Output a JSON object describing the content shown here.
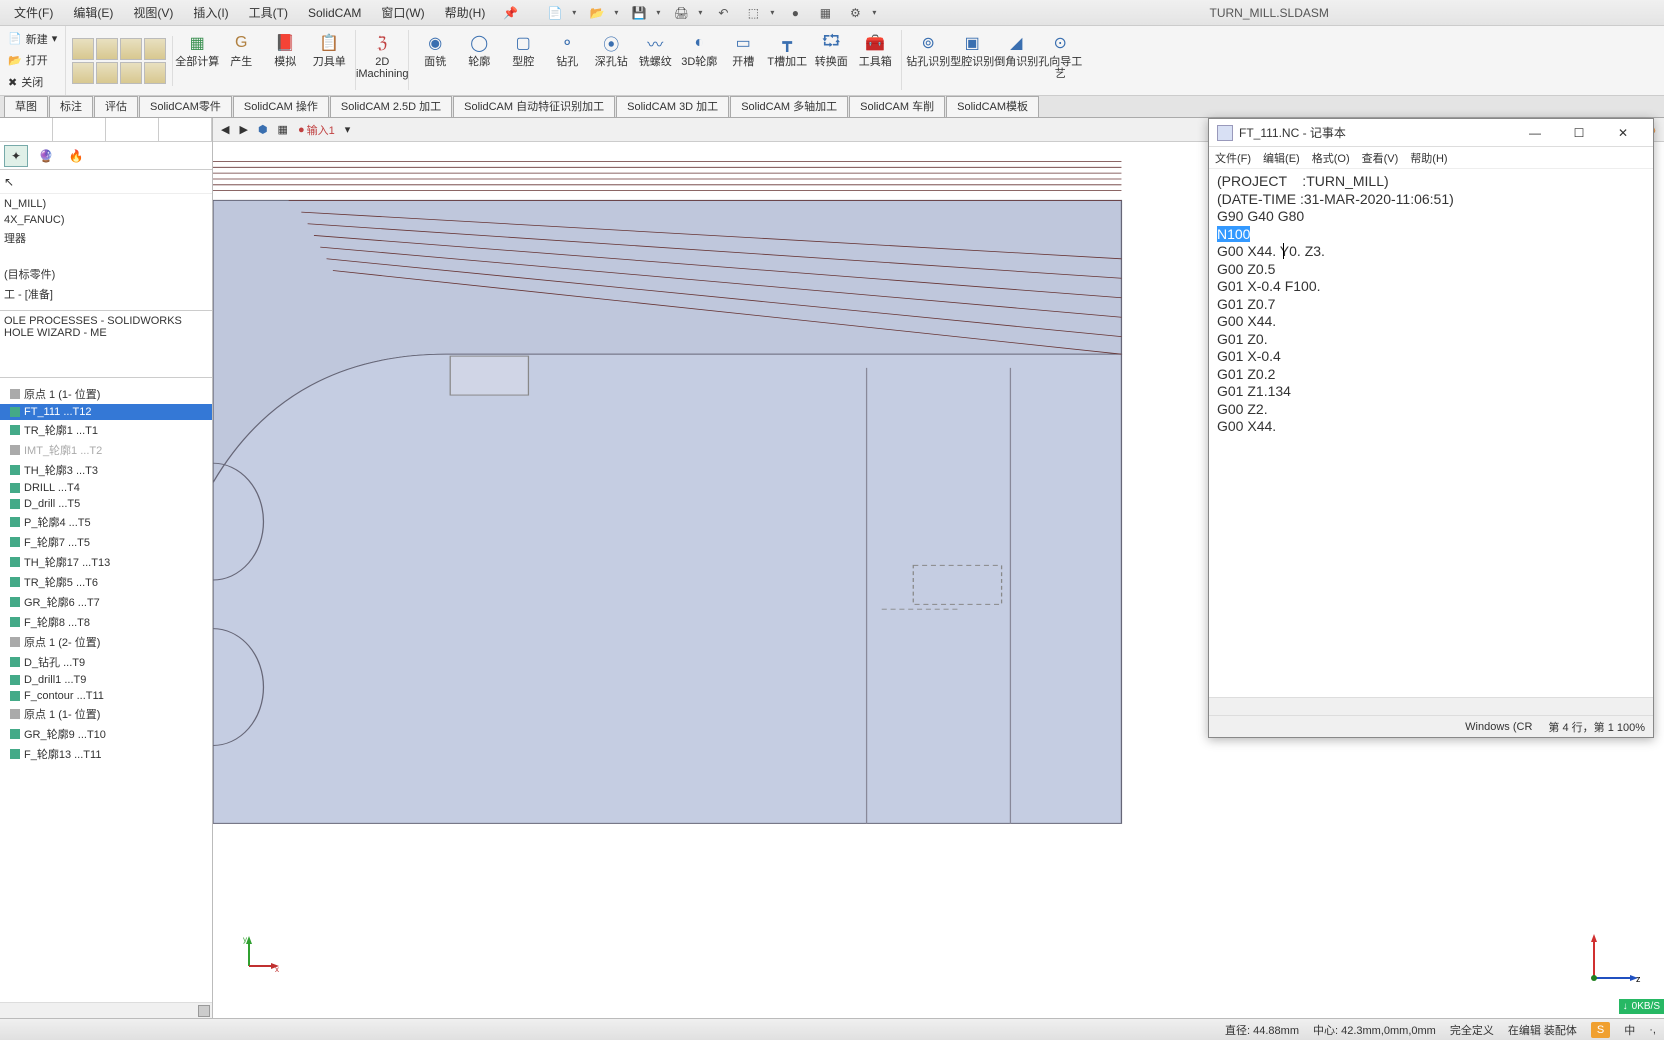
{
  "menu": {
    "file": "文件(F)",
    "edit": "编辑(E)",
    "view": "视图(V)",
    "insert": "插入(I)",
    "tool": "工具(T)",
    "solidcam": "SolidCAM",
    "window": "窗口(W)",
    "help": "帮助(H)",
    "title": "TURN_MILL.SLDASM"
  },
  "quick": {
    "new": "新建",
    "open": "打开",
    "close": "关闭"
  },
  "ribbon": {
    "all": "全部计算",
    "gen": "产生",
    "sim": "模拟",
    "tool": "刀具单",
    "twod": "2D iMachining",
    "mill": "面铣",
    "con": "轮廓",
    "typ": "型腔",
    "drill": "钻孔",
    "deep": "深孔钻",
    "thread": "铣螺纹",
    "con3d": "3D轮廓",
    "slot": "开槽",
    "t_proc": "T槽加工",
    "transform": "转换面",
    "toolbox": "工具箱",
    "drill_rec": "钻孔识别",
    "typ_rec": "型腔识别",
    "cham_rec": "倒角识别",
    "hole_guide": "孔向导工艺"
  },
  "tabs": {
    "sketch": "草图",
    "anno": "标注",
    "eval": "评估",
    "part": "SolidCAM零件",
    "op": "SolidCAM 操作",
    "p25": "SolidCAM 2.5D 加工",
    "auto": "SolidCAM 自动特征识别加工",
    "p3d": "SolidCAM 3D 加工",
    "multi": "SolidCAM 多轴加工",
    "turn": "SolidCAM 车削",
    "tpl": "SolidCAM模板"
  },
  "vp_toolbar": {
    "input": "输入1"
  },
  "tree_top": {
    "t1": "N_MILL)",
    "t2": "4X_FANUC)",
    "t3": "理器",
    "t4": "(目标零件)",
    "t5": "工 - [准备]",
    "hole": "OLE PROCESSES - SOLIDWORKS HOLE WIZARD - ME"
  },
  "ops": [
    {
      "label": "原点 1 (1- 位置)",
      "cls": ""
    },
    {
      "label": "FT_111 ...T12",
      "cls": "selected"
    },
    {
      "label": "TR_轮廓1 ...T1",
      "cls": ""
    },
    {
      "label": "IMT_轮廓1 ...T2",
      "cls": "dim"
    },
    {
      "label": "TH_轮廓3 ...T3",
      "cls": ""
    },
    {
      "label": "DRILL ...T4",
      "cls": ""
    },
    {
      "label": "D_drill ...T5",
      "cls": ""
    },
    {
      "label": "P_轮廓4 ...T5",
      "cls": ""
    },
    {
      "label": "F_轮廓7 ...T5",
      "cls": ""
    },
    {
      "label": "TH_轮廓17 ...T13",
      "cls": ""
    },
    {
      "label": "TR_轮廓5 ...T6",
      "cls": ""
    },
    {
      "label": "GR_轮廓6 ...T7",
      "cls": ""
    },
    {
      "label": "F_轮廓8 ...T8",
      "cls": ""
    },
    {
      "label": "原点 1 (2- 位置)",
      "cls": ""
    },
    {
      "label": "D_钻孔 ...T9",
      "cls": ""
    },
    {
      "label": "D_drill1 ...T9",
      "cls": ""
    },
    {
      "label": "F_contour ...T11",
      "cls": ""
    },
    {
      "label": "原点 1 (1- 位置)",
      "cls": ""
    },
    {
      "label": "GR_轮廓9 ...T10",
      "cls": ""
    },
    {
      "label": "F_轮廓13 ...T11",
      "cls": ""
    }
  ],
  "notepad": {
    "title": "FT_111.NC - 记事本",
    "menu": {
      "file": "文件(F)",
      "edit": "编辑(E)",
      "format": "格式(O)",
      "view": "查看(V)",
      "help": "帮助(H)"
    },
    "lines": [
      "(PROJECT    :TURN_MILL)",
      "(DATE-TIME :31-MAR-2020-11:06:51)",
      "G90 G40 G80",
      "N100",
      "G00 X44. Y0. Z3.",
      "G00 Z0.5",
      "G01 X-0.4 F100.",
      "G01 Z0.7",
      "G00 X44.",
      "G01 Z0.",
      "G01 X-0.4",
      "G01 Z0.2",
      "G01 Z1.134",
      "G00 Z2.",
      "G00 X44."
    ],
    "highlight_line": 3,
    "status": {
      "platform": "Windows (CR",
      "pos": "第 4 行，第 1 100%"
    }
  },
  "status": {
    "diameter": "直径: 44.88mm",
    "center": "中心: 42.3mm,0mm,0mm",
    "def": "完全定义",
    "mode": "在编辑 装配体",
    "ime": "中",
    "net": "0KB/S"
  },
  "axis": {
    "y": "y",
    "x": "x",
    "z": "z"
  }
}
